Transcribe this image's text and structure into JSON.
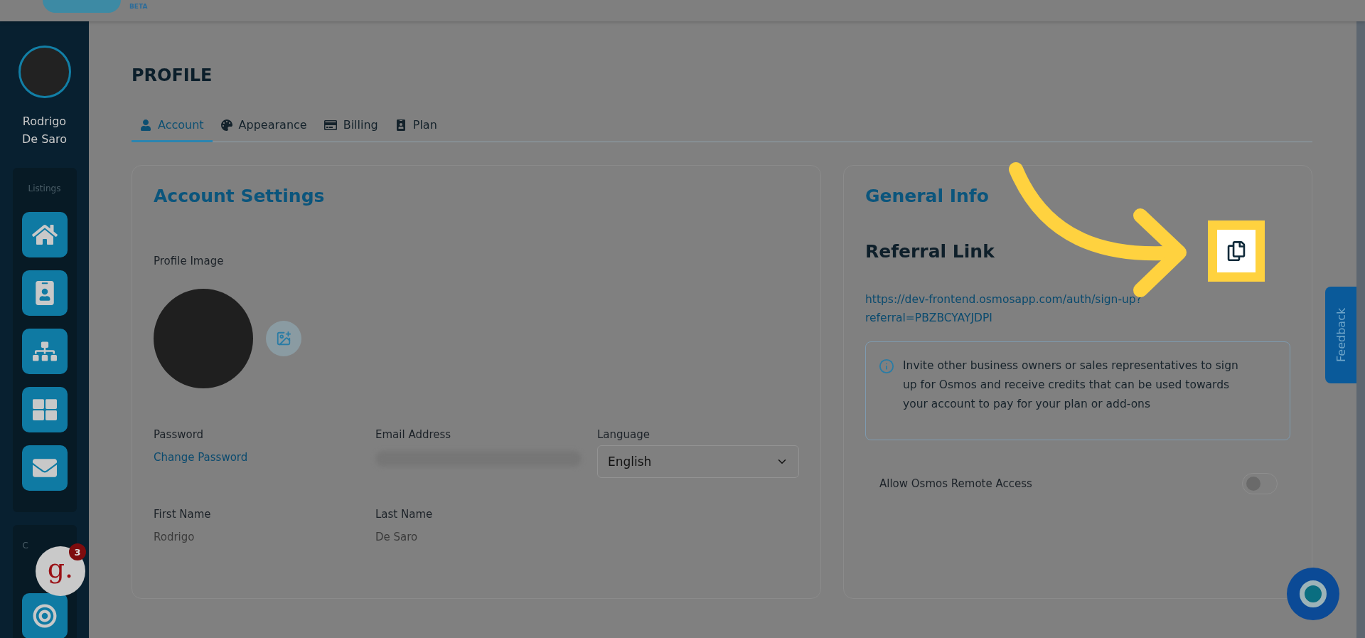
{
  "header": {
    "badge": "BETA"
  },
  "sidebar": {
    "user_name": "Rodrigo De Saro",
    "groups": [
      {
        "label": "Listings",
        "items": [
          {
            "kind": "home"
          },
          {
            "kind": "contact"
          },
          {
            "kind": "hierarchy"
          },
          {
            "kind": "grid"
          },
          {
            "kind": "mail"
          }
        ]
      },
      {
        "label": "C",
        "items": [
          {
            "kind": "target"
          }
        ]
      }
    ]
  },
  "page_title": "PROFILE",
  "tabs": [
    {
      "label": "Account",
      "kind": "user",
      "selected": true
    },
    {
      "label": "Appearance",
      "kind": "palette",
      "selected": false
    },
    {
      "label": "Billing",
      "kind": "card",
      "selected": false
    },
    {
      "label": "Plan",
      "kind": "badge",
      "selected": false
    }
  ],
  "account_settings": {
    "title": "Account Settings",
    "profile_image_label": "Profile Image",
    "fields": [
      {
        "label": "Password",
        "value": "Change Password",
        "kind": "link"
      },
      {
        "label": "Email Address",
        "kind": "blurred"
      },
      {
        "label": "Language",
        "value": "English",
        "kind": "select"
      },
      {
        "label": "First Name",
        "value": "Rodrigo",
        "kind": "text"
      },
      {
        "label": "Last Name",
        "value": "De Saro",
        "kind": "text"
      }
    ]
  },
  "general_info": {
    "title": "General Info",
    "referral_heading": "Referral Link",
    "referral_url": "https://dev-frontend.osmosapp.com/auth/sign-up?referral=PBZBCYAYJDPI",
    "info_text": "Invite other business owners or sales representatives to sign up for Osmos and receive credits that can be used towards your account to pay for your plan or add-ons",
    "remote_access": {
      "label": "Allow Osmos Remote Access",
      "on": false
    }
  },
  "feedback_tab": "Feedback",
  "chat_widget": {
    "logo": "g.",
    "count": "3"
  }
}
